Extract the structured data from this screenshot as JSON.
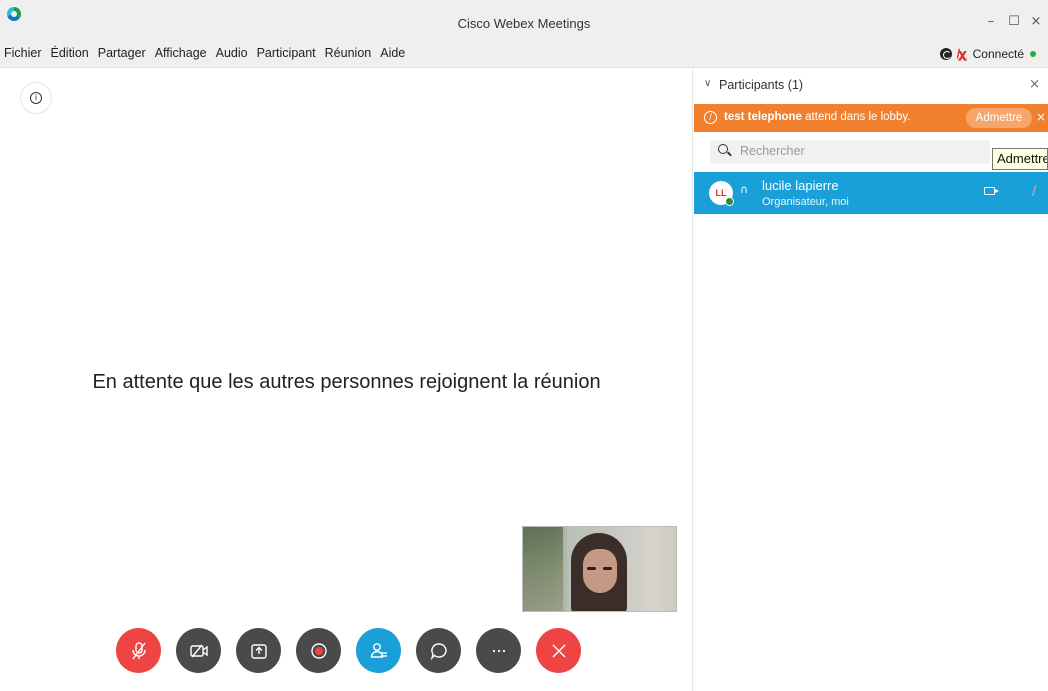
{
  "window": {
    "title": "Cisco Webex Meetings",
    "minimize": "–",
    "maximize": "☐",
    "close": "×"
  },
  "menu": [
    "Fichier",
    "Édition",
    "Partager",
    "Affichage",
    "Audio",
    "Participant",
    "Réunion",
    "Aide"
  ],
  "status": {
    "connection": "Connecté",
    "connected_color": "#2eaa3b"
  },
  "stage": {
    "info_icon": "info-icon",
    "waiting_message": "En attente que les autres personnes rejoignent la réunion"
  },
  "toolbar": [
    {
      "name": "mute-button",
      "icon": "mic-muted-icon",
      "color": "#ef4444"
    },
    {
      "name": "video-button",
      "icon": "video-off-icon",
      "color": "#4a4a4a"
    },
    {
      "name": "share-button",
      "icon": "share-icon",
      "color": "#4a4a4a"
    },
    {
      "name": "record-button",
      "icon": "record-icon",
      "color": "#4a4a4a"
    },
    {
      "name": "participants-button",
      "icon": "participants-icon",
      "color": "#1a9fd8"
    },
    {
      "name": "chat-button",
      "icon": "chat-icon",
      "color": "#4a4a4a"
    },
    {
      "name": "more-button",
      "icon": "more-icon",
      "color": "#4a4a4a"
    },
    {
      "name": "leave-button",
      "icon": "close-icon",
      "color": "#ef4444"
    }
  ],
  "participants_panel": {
    "title": "Participants (1)",
    "close": "×",
    "lobby": {
      "name": "test telephone",
      "message": " attend dans le lobby.",
      "admit_label": "Admettre",
      "close": "×",
      "color": "#f0802d"
    },
    "tooltip": "Admettre",
    "search_placeholder": "Rechercher",
    "participants": [
      {
        "initials": "LL",
        "name": "lucile lapierre",
        "role": "Organisateur, moi",
        "row_color": "#1aa0d8"
      }
    ]
  }
}
